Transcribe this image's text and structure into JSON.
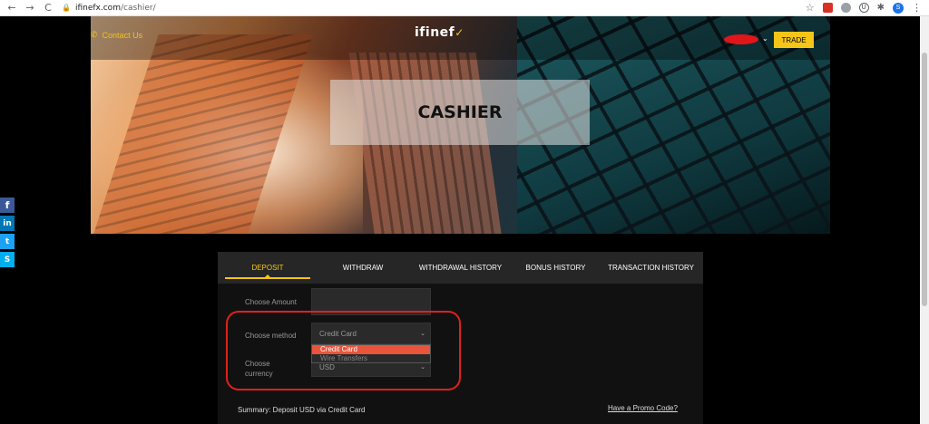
{
  "browser": {
    "back": "←",
    "forward": "→",
    "reload": "C",
    "url_domain": "ifinefx.com",
    "url_path": "/cashier/",
    "profile_initial": "S"
  },
  "header": {
    "contact_label": "Contact Us",
    "logo_text": "ifinef",
    "logo_tagline": "",
    "trade_label": "TRADE"
  },
  "hero": {
    "title": "CASHIER"
  },
  "social": [
    {
      "name": "facebook",
      "glyph": "f"
    },
    {
      "name": "linkedin",
      "glyph": "in"
    },
    {
      "name": "twitter",
      "glyph": "t"
    },
    {
      "name": "skype",
      "glyph": "S"
    }
  ],
  "tabs": [
    {
      "label": "DEPOSIT",
      "active": true
    },
    {
      "label": "WITHDRAW",
      "active": false
    },
    {
      "label": "WITHDRAWAL HISTORY",
      "active": false
    },
    {
      "label": "BONUS HISTORY",
      "active": false
    },
    {
      "label": "TRANSACTION HISTORY",
      "active": false
    }
  ],
  "form": {
    "amount_label": "Choose Amount",
    "amount_value": "",
    "method_label": "Choose method",
    "method_value": "Credit Card",
    "method_options": [
      "Credit Card",
      "Wire Transfers"
    ],
    "currency_label_line1": "Choose",
    "currency_label_line2": "currency",
    "currency_value": "USD"
  },
  "summary": "Summary: Deposit  USD via Credit Card",
  "promo_link": "Have a Promo Code?",
  "colors": {
    "accent": "#f5c518",
    "highlight": "#e0211c",
    "selected_option": "#e8553a"
  }
}
